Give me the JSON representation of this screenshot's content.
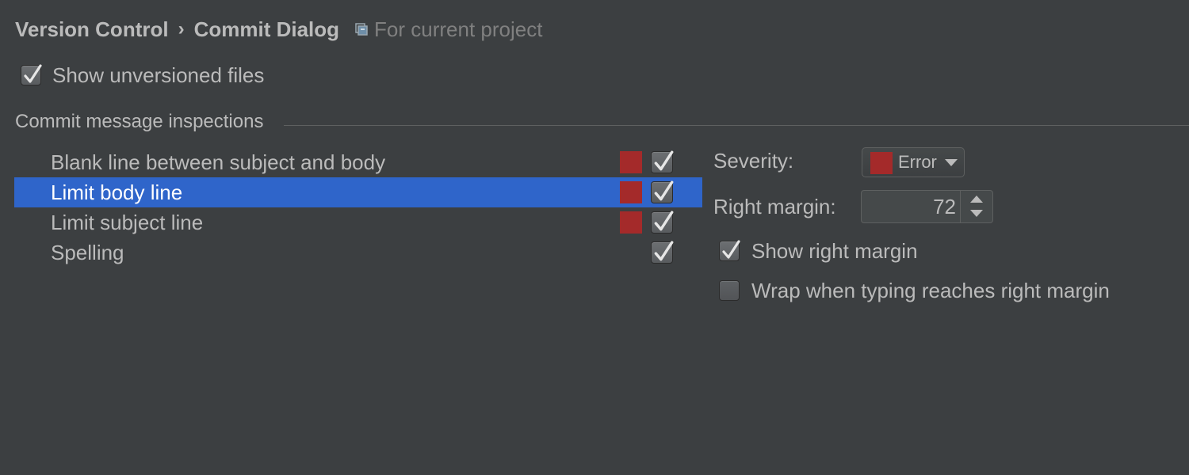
{
  "breadcrumb": {
    "parent": "Version Control",
    "separator": "›",
    "current": "Commit Dialog",
    "scope_icon": "project-scope-icon",
    "scope_text": "For current project"
  },
  "show_unversioned": {
    "label": "Show unversioned files",
    "checked": true
  },
  "inspections": {
    "title": "Commit message inspections",
    "items": [
      {
        "label": "Blank line between subject and body",
        "severity_color": "#a42a2a",
        "enabled": true,
        "selected": false
      },
      {
        "label": "Limit body line",
        "severity_color": "#a42a2a",
        "enabled": true,
        "selected": true
      },
      {
        "label": "Limit subject line",
        "severity_color": "#a42a2a",
        "enabled": true,
        "selected": false
      },
      {
        "label": "Spelling",
        "severity_color": null,
        "enabled": true,
        "selected": false
      }
    ]
  },
  "options": {
    "severity_label": "Severity:",
    "severity_value": "Error",
    "severity_color": "#a42a2a",
    "right_margin_label": "Right margin:",
    "right_margin_value": "72",
    "show_right_margin_label": "Show right margin",
    "show_right_margin_checked": true,
    "wrap_label": "Wrap when typing reaches right margin",
    "wrap_checked": false
  },
  "colors": {
    "background": "#3c3f41",
    "selection": "#2f65ca",
    "error": "#a42a2a"
  }
}
